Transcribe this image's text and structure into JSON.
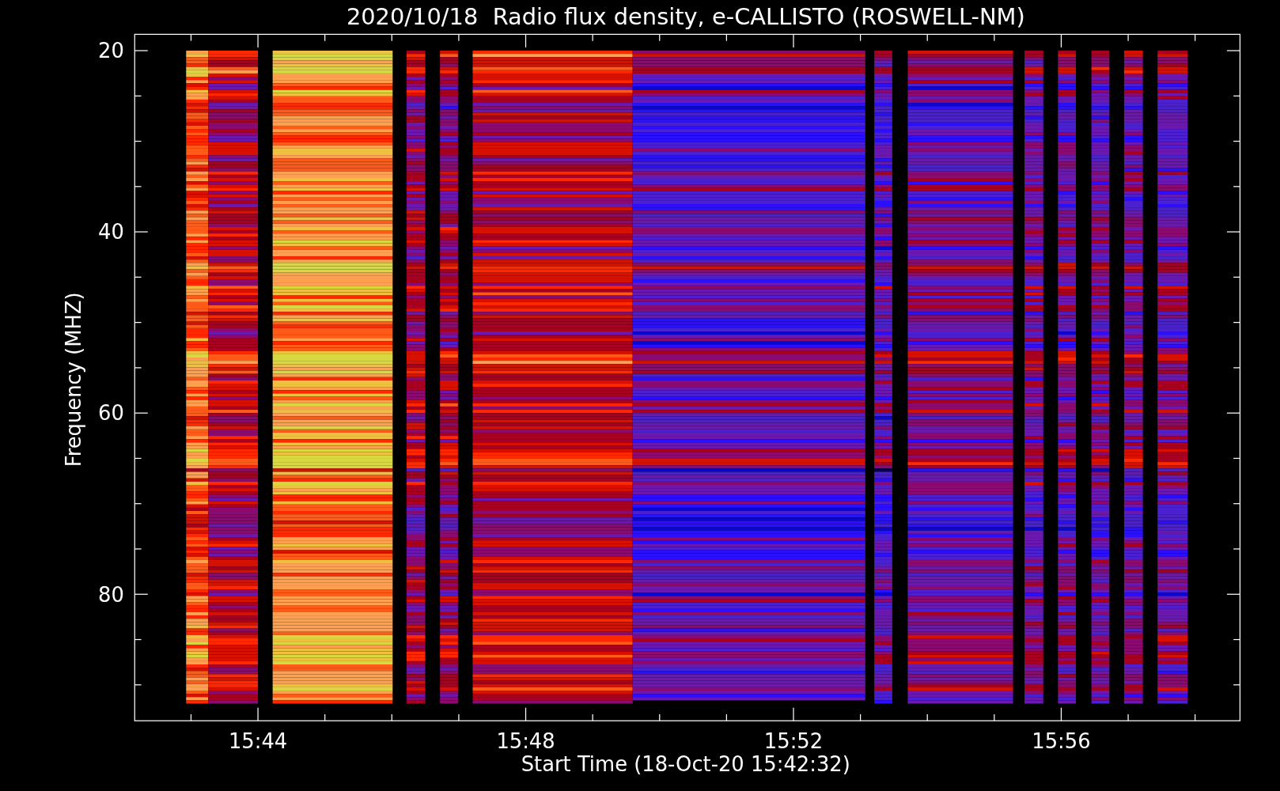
{
  "title": "2020/10/18  Radio flux density, e-CALLISTO (ROSWELL-NM)",
  "y_axis": {
    "label": "Frequency (MHZ)",
    "tick_labels": [
      "20",
      "40",
      "60",
      "80"
    ]
  },
  "x_axis": {
    "label": "Start Time (18-Oct-20 15:42:32)",
    "tick_labels": [
      "15:44",
      "15:48",
      "15:52",
      "15:56"
    ]
  }
}
